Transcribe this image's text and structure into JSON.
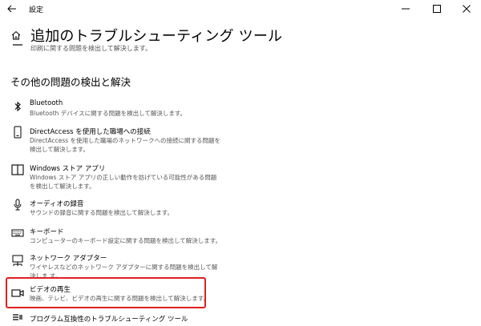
{
  "window": {
    "app_title": "設定",
    "back_icon": "back-arrow-icon",
    "minimize_icon": "minimize-icon",
    "maximize_icon": "maximize-icon",
    "close_icon": "close-icon"
  },
  "header": {
    "home_icon": "home-icon",
    "title": "追加のトラブルシューティング ツール"
  },
  "partial_item": {
    "icon": "printer-icon",
    "description": "印刷に関する問題を検出して解決します。"
  },
  "section": {
    "title": "その他の問題の検出と解決"
  },
  "items": [
    {
      "icon": "bluetooth-icon",
      "name": "Bluetooth",
      "description": "Bluetooth デバイスに関する問題を検出して解決します。"
    },
    {
      "icon": "phone-icon",
      "name": "DirectAccess を使用した職場への接続",
      "description": "DirectAccess を使用した職場のネットワークへの接続に関する問題を検出して解決します。"
    },
    {
      "icon": "store-icon",
      "name": "Windows ストア アプリ",
      "description": "Windows ストア アプリの正しい動作を妨げている可能性がある問題を検出して解決します。"
    },
    {
      "icon": "microphone-icon",
      "name": "オーディオの録音",
      "description": "サウンドの録音に関する問題を検出して解決します。"
    },
    {
      "icon": "keyboard-icon",
      "name": "キーボード",
      "description": "コンピューターのキーボード設定に関する問題を検出して解決します。"
    },
    {
      "icon": "network-adapter-icon",
      "name": "ネットワーク アダプター",
      "description": "ワイヤレスなどのネットワーク アダプターに関する問題を検出して解決しま す。"
    },
    {
      "icon": "video-camera-icon",
      "name": "ビデオの再生",
      "description": "映画、テレビ、ビデオの再生に関する問題を検出して解決します。"
    },
    {
      "icon": "compatibility-icon",
      "name": "プログラム互換性のトラブルシューティング ツール",
      "description": ""
    }
  ],
  "highlight_color": "#e02020"
}
